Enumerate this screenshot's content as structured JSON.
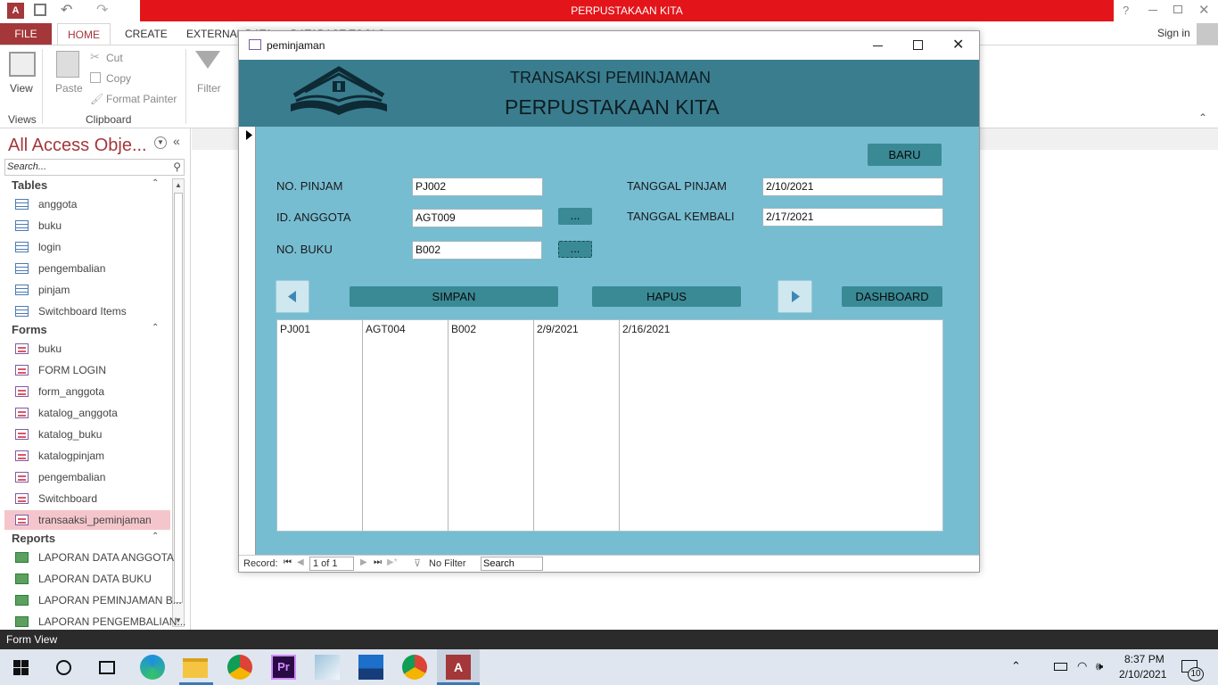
{
  "app": {
    "title": "PERPUSTAKAAN KITA",
    "help": "?",
    "sign_in": "Sign in"
  },
  "ribbon_tabs": [
    "FILE",
    "HOME",
    "CREATE",
    "EXTERNAL DATA",
    "DATABASE TOOLS"
  ],
  "ribbon": {
    "view": "View",
    "views_group": "Views",
    "paste": "Paste",
    "cut": "Cut",
    "copy": "Copy",
    "format_painter": "Format Painter",
    "clipboard_group": "Clipboard",
    "filter": "Filter"
  },
  "nav": {
    "title": "All Access Obje...",
    "search_placeholder": "Search...",
    "tables_header": "Tables",
    "tables": [
      "anggota",
      "buku",
      "login",
      "pengembalian",
      "pinjam",
      "Switchboard Items"
    ],
    "forms_header": "Forms",
    "forms": [
      "buku",
      "FORM LOGIN",
      "form_anggota",
      "katalog_anggota",
      "katalog_buku",
      "katalogpinjam",
      "pengembalian",
      "Switchboard",
      "transaaksi_peminjaman"
    ],
    "reports_header": "Reports",
    "reports": [
      "LAPORAN DATA ANGGOTA",
      "LAPORAN DATA BUKU",
      "LAPORAN PEMINJAMAN B...",
      "LAPORAN PENGEMBALIAN..."
    ]
  },
  "form_window": {
    "title": "peminjaman",
    "header_line1": "TRANSAKSI PEMINJAMAN",
    "header_line2": "PERPUSTAKAAN KITA",
    "baru": "BARU",
    "fields": {
      "no_pinjam_label": "NO. PINJAM",
      "no_pinjam": "PJ002",
      "id_anggota_label": "ID. ANGGOTA",
      "id_anggota": "AGT009",
      "no_buku_label": "NO. BUKU",
      "no_buku": "B002",
      "tanggal_pinjam_label": "TANGGAL PINJAM",
      "tanggal_pinjam": "2/10/2021",
      "tanggal_kembali_label": "TANGGAL KEMBALI",
      "tanggal_kembali": "2/17/2021"
    },
    "lookup_button": "...",
    "simpan": "SIMPAN",
    "hapus": "HAPUS",
    "dashboard": "DASHBOARD",
    "grid_row": [
      "PJ001",
      "AGT004",
      "B002",
      "2/9/2021",
      "2/16/2021"
    ],
    "record_nav": {
      "label": "Record:",
      "position": "1 of 1",
      "filter": "No Filter",
      "search": "Search"
    }
  },
  "status": "Form View",
  "taskbar": {
    "time": "8:37 PM",
    "date": "2/10/2021",
    "notifications": "10"
  }
}
